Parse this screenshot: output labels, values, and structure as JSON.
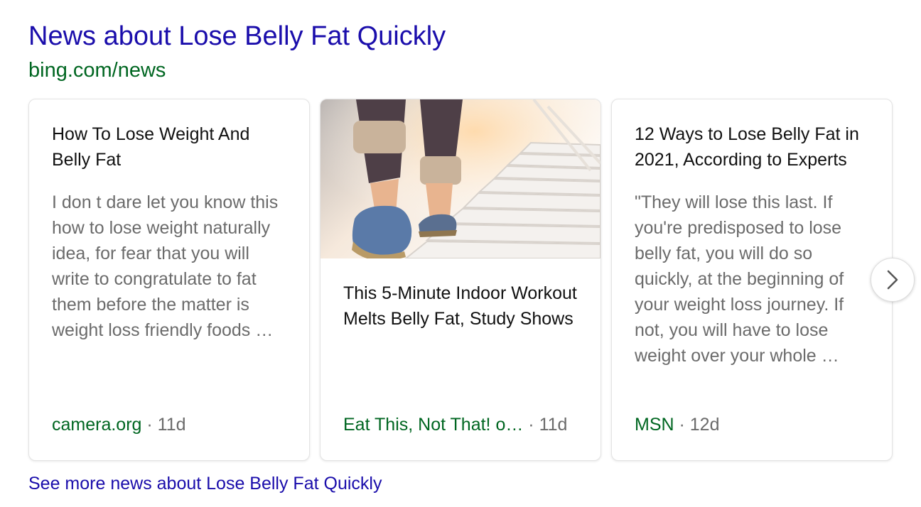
{
  "header": {
    "title": "News about Lose Belly Fat Quickly",
    "source_url": "bing.com/news"
  },
  "cards": [
    {
      "title": "How To Lose Weight And Belly Fat",
      "snippet": "I don t dare let you know this how to lose weight naturally idea, for fear that you will write to congratulate to fat them before the matter is weight loss friendly foods …",
      "source": "camera.org",
      "separator": " · ",
      "age": "11d"
    },
    {
      "title": "This 5-Minute Indoor Workout Melts Belly Fat, Study Shows",
      "image_icon": "stairs-walking-photo",
      "source": "Eat This, Not That! o…",
      "separator": " · ",
      "age": "11d"
    },
    {
      "title": "12 Ways to Lose Belly Fat in 2021, According to Experts",
      "snippet": "\"They will lose this last. If you're predisposed to lose belly fat, you will do so quickly, at the beginning of your weight loss journey. If not, you will have to lose weight over your whole …",
      "source": "MSN",
      "separator": " · ",
      "age": "12d"
    }
  ],
  "carousel": {
    "next_icon": "chevron-right-icon"
  },
  "footer": {
    "see_more": "See more news about Lose Belly Fat Quickly"
  },
  "colors": {
    "link": "#1a0dab",
    "url_green": "#006621",
    "snippet_gray": "#6b6b6b",
    "title_dark": "#111111"
  }
}
